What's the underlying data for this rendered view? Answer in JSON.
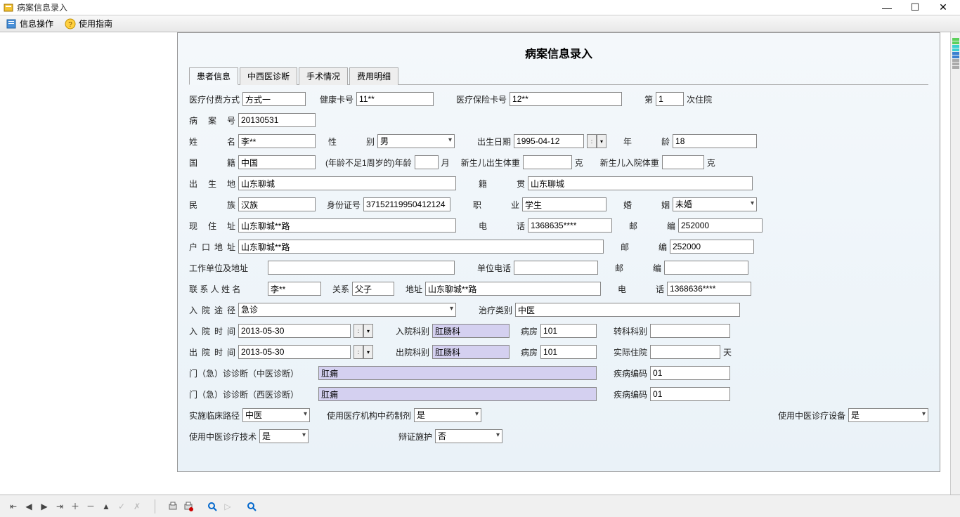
{
  "window": {
    "title": "病案信息录入"
  },
  "menu": {
    "item1": "信息操作",
    "item2": "使用指南"
  },
  "page_title": "病案信息录入",
  "tabs": [
    "患者信息",
    "中西医诊断",
    "手术情况",
    "费用明细"
  ],
  "labels": {
    "payment": "医疗付费方式",
    "healthcard": "健康卡号",
    "insurance": "医疗保险卡号",
    "visit_prefix": "第",
    "visit_suffix": "次住院",
    "case_no": "病 案 号",
    "name": "姓       名",
    "sex": "性       别",
    "dob": "出生日期",
    "age": "年       龄",
    "nationality": "国       籍",
    "age_under1": "(年龄不足1周岁的)年龄",
    "month": "月",
    "birth_weight": "新生儿出生体重",
    "gram": "克",
    "admit_weight": "新生儿入院体重",
    "birthplace": "出 生 地",
    "hometown": "籍       贯",
    "ethnic": "民       族",
    "id_no": "身份证号",
    "occupation": "职       业",
    "marriage": "婚       姻",
    "address": "现 住 址",
    "phone": "电       话",
    "zipcode": "邮       编",
    "reg_address": "户口地址",
    "work_address": "工作单位及地址",
    "work_phone": "单位电话",
    "contact_name": "联 系 人 姓 名",
    "relation": "关系",
    "addr_short": "地址",
    "admit_route": "入院途径",
    "treat_type": "治疗类别",
    "admit_time": "入院时间",
    "admit_dept": "入院科别",
    "ward": "病房",
    "transfer_dept": "转科科别",
    "discharge_time": "出院时间",
    "discharge_dept": "出院科别",
    "actual_stay": "实际住院",
    "days": "天",
    "outpatient_tcm": "门（急）诊诊断（中医诊断）",
    "disease_code": "疾病编码",
    "outpatient_wm": "门（急）诊诊断（西医诊断）",
    "clinical_path": "实施临床路径",
    "tcm_prep": "使用医疗机构中药制剂",
    "tcm_equip": "使用中医诊疗设备",
    "tcm_tech": "使用中医诊疗技术",
    "dialectic": "辩证施护"
  },
  "values": {
    "payment": "方式一",
    "healthcard": "11**",
    "insurance": "12**",
    "visit_count": "1",
    "case_no": "20130531",
    "name": "李**",
    "sex": "男",
    "dob": "1995-04-12",
    "age": "18",
    "nationality": "中国",
    "age_under1": "",
    "birth_weight": "",
    "admit_weight": "",
    "birthplace": "山东聊城",
    "hometown": "山东聊城",
    "ethnic": "汉族",
    "id_no": "37152119950412124",
    "occupation": "学生",
    "marriage": "未婚",
    "address": "山东聊城**路",
    "phone": "1368635****",
    "zipcode": "252000",
    "reg_address": "山东聊城**路",
    "zipcode2": "252000",
    "work_address": "",
    "work_phone": "",
    "zipcode3": "",
    "contact_name": "李**",
    "relation": "父子",
    "contact_addr": "山东聊城**路",
    "contact_phone": "1368636****",
    "admit_route": "急诊",
    "treat_type": "中医",
    "admit_time": "2013-05-30",
    "admit_dept": "肛肠科",
    "admit_ward": "101",
    "transfer_dept": "",
    "discharge_time": "2013-05-30",
    "discharge_dept": "肛肠科",
    "discharge_ward": "101",
    "actual_stay": "",
    "outpatient_tcm": "肛痈",
    "disease_code1": "01",
    "outpatient_wm": "肛痈",
    "disease_code2": "01",
    "clinical_path": "中医",
    "tcm_prep": "是",
    "tcm_equip": "是",
    "tcm_tech": "是",
    "dialectic": "否"
  }
}
